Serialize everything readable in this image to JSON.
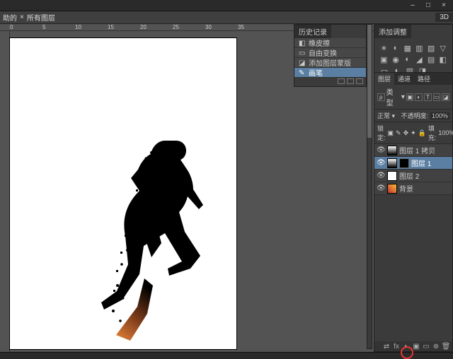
{
  "titlebar": {
    "minimize": "–",
    "maximize": "□",
    "close": "×"
  },
  "tabs": {
    "current": "助的",
    "sep": "×",
    "desc": "所有图层",
    "subtab": "3D"
  },
  "ruler": {
    "t0": "0",
    "t1": "5",
    "t2": "10",
    "t3": "15",
    "t4": "20",
    "t5": "25",
    "t6": "30",
    "t7": "35"
  },
  "history": {
    "title": "历史记录",
    "items": [
      {
        "icon": "brush",
        "label": "橡皮擦"
      },
      {
        "icon": "transform",
        "label": "自由变换"
      },
      {
        "icon": "mask",
        "label": "添加图层蒙版"
      },
      {
        "icon": "brush",
        "label": "画笔"
      }
    ]
  },
  "adjust": {
    "title": "添加调整",
    "row1": [
      "☀",
      "◐",
      "▦",
      "▥",
      "▨",
      "▽"
    ],
    "row2": [
      "▣",
      "◉",
      "◐",
      "◢",
      "▤",
      "◧"
    ],
    "row3": [
      "▭",
      "◐",
      "▥",
      "◨"
    ]
  },
  "layers": {
    "tabs": [
      "图层",
      "通道",
      "路径"
    ],
    "kind_label": "类型",
    "filters": [
      "▣",
      "◐",
      "T",
      "▭",
      "◪"
    ],
    "blend_label": "正常",
    "opacity_label": "不透明度:",
    "opacity_value": "100%",
    "lock_label": "锁定:",
    "lock_icons": [
      "▣",
      "✎",
      "✥",
      "✦",
      "🔒"
    ],
    "fill_label": "填充:",
    "fill_value": "100%",
    "items": [
      {
        "name": "图层 1 拷贝",
        "sel": false,
        "mask": false,
        "thumb": "runner"
      },
      {
        "name": "图层 1",
        "sel": true,
        "mask": true,
        "thumb": "runner"
      },
      {
        "name": "图层 2",
        "sel": false,
        "mask": false,
        "thumb": "white"
      },
      {
        "name": "背景",
        "sel": false,
        "mask": false,
        "thumb": "grad"
      }
    ],
    "foot": [
      "⇄",
      "fx",
      "◐",
      "▣",
      "▭",
      "⊕",
      "🗑"
    ]
  }
}
